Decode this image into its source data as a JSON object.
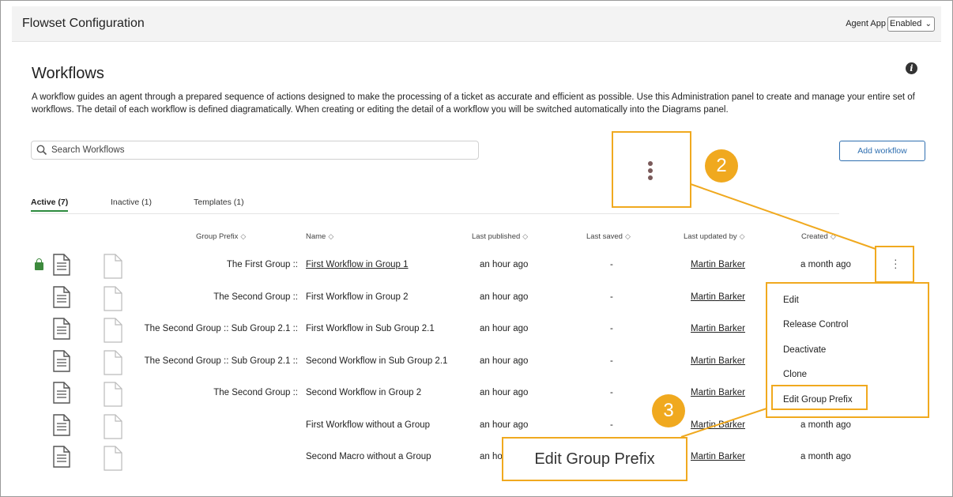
{
  "topbar": {
    "title": "Flowset Configuration",
    "agent_label": "Agent App",
    "agent_select_value": "Enabled"
  },
  "page": {
    "title": "Workflows",
    "description": "A workflow guides an agent through a prepared sequence of actions designed to make the processing of a ticket as accurate and efficient as possible. Use this Administration panel to create and manage your entire set of workflows. The detail of each workflow is defined diagramatically. When creating or editing the detail of a workflow you will be switched automatically into the Diagrams panel."
  },
  "search": {
    "placeholder": "Search Workflows"
  },
  "add_button": "Add workflow",
  "tabs": [
    {
      "label": "Active (7)",
      "active": true
    },
    {
      "label": "Inactive (1)"
    },
    {
      "label": "Templates (1)"
    }
  ],
  "columns": {
    "group_prefix": "Group Prefix",
    "name": "Name",
    "last_published": "Last published",
    "last_saved": "Last saved",
    "last_updated_by": "Last updated by",
    "created": "Created"
  },
  "rows": [
    {
      "prefix": "The First Group ::",
      "name": "First Workflow in Group 1",
      "published": "an hour ago",
      "saved": "-",
      "updated_by": "Martin Barker",
      "created": "a month ago",
      "locked": true
    },
    {
      "prefix": "The Second Group ::",
      "name": "First Workflow in Group 2",
      "published": "an hour ago",
      "saved": "-",
      "updated_by": "Martin Barker",
      "created": ""
    },
    {
      "prefix": "The Second Group :: Sub Group 2.1 ::",
      "name": "First Workflow in Sub Group 2.1",
      "published": "an hour ago",
      "saved": "-",
      "updated_by": "Martin Barker",
      "created": ""
    },
    {
      "prefix": "The Second Group :: Sub Group 2.1 ::",
      "name": "Second Workflow in Sub Group 2.1",
      "published": "an hour ago",
      "saved": "-",
      "updated_by": "Martin Barker",
      "created": ""
    },
    {
      "prefix": "The Second Group ::",
      "name": "Second Workflow in Group 2",
      "published": "an hour ago",
      "saved": "-",
      "updated_by": "Martin Barker",
      "created": ""
    },
    {
      "prefix": "",
      "name": "First Workflow without a Group",
      "published": "an hour ago",
      "saved": "-",
      "updated_by": "Martin Barker",
      "created": "a month ago"
    },
    {
      "prefix": "",
      "name": "Second Macro without a Group",
      "published": "an ho",
      "saved": "",
      "updated_by": "Martin Barker",
      "created": "a month ago"
    }
  ],
  "menu": {
    "items": [
      "Edit",
      "Release Control",
      "Deactivate",
      "Clone",
      "Edit Group Prefix"
    ]
  },
  "callouts": {
    "two": "2",
    "three": "3"
  },
  "zoom_label": "Edit Group Prefix",
  "colors": {
    "accent": "#f0a91f",
    "active_tab": "#2d8a3e",
    "link_button": "#2f6fb0",
    "lock": "#3d8a3d"
  }
}
